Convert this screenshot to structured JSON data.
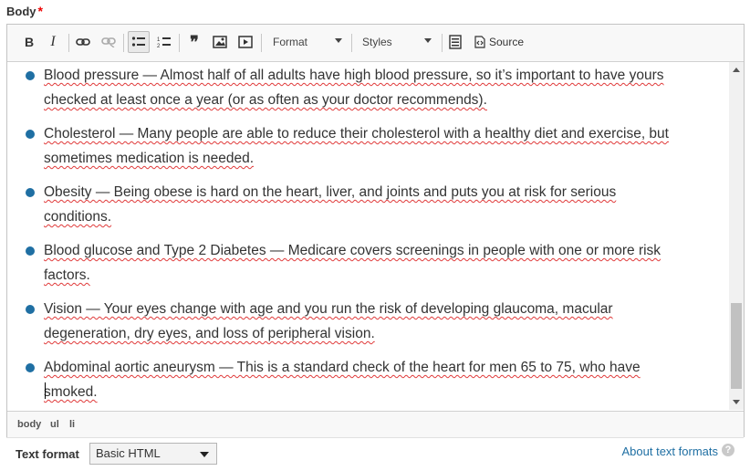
{
  "field": {
    "label": "Body",
    "required_mark": "*"
  },
  "toolbar": {
    "bold": "B",
    "italic": "I",
    "format_select": "Format",
    "styles_select": "Styles",
    "source": "Source"
  },
  "content": {
    "items": [
      {
        "text": "Blood pressure — Almost half of all adults have high blood pressure, so it’s important to have yours checked at least once a year (or as often as your doctor recommends)."
      },
      {
        "text": "Cholesterol — Many people are able to reduce their cholesterol with a healthy diet and exercise, but sometimes medication is needed."
      },
      {
        "text": "Obesity — Being obese is hard on the heart, liver, and joints and puts you at risk for serious conditions."
      },
      {
        "text": "Blood glucose and Type 2 Diabetes — Medicare covers screenings in people with one or more risk factors."
      },
      {
        "text": "Vision — Your eyes change with age  and you run the risk of developing glaucoma, macular degeneration, dry eyes, and loss of peripheral vision."
      },
      {
        "text": "Abdominal aortic aneurysm — This is a standard check of the heart for men 65 to 75, who have smoked."
      }
    ]
  },
  "elements_path": [
    "body",
    "ul",
    "li"
  ],
  "text_format": {
    "label": "Text format",
    "selected": "Basic HTML",
    "about_link": "About text formats",
    "help": "?"
  },
  "colors": {
    "bullet": "#1f6fa3",
    "link": "#1f6fa3",
    "spellcheck": "#e03a3a",
    "required": "#e00000"
  }
}
